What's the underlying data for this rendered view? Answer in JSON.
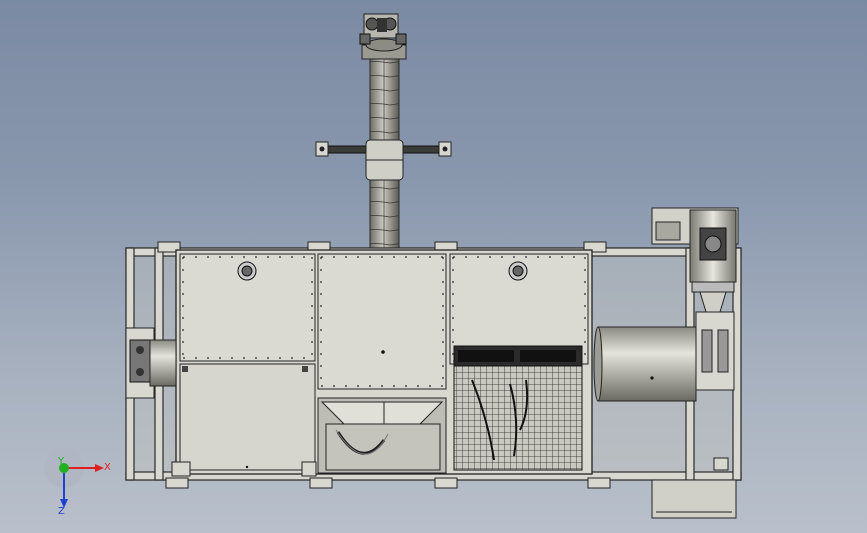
{
  "triad": {
    "x_label": "X",
    "y_label": "Y",
    "z_label": "Z",
    "x_color": "#e02020",
    "y_color": "#20b020",
    "z_color": "#2040d0"
  },
  "colors": {
    "metal_fill": "#d8d8d0",
    "metal_stroke": "#2a2a2a",
    "background_top": "#7b8aa3",
    "background_bottom": "#b9c0cb"
  }
}
